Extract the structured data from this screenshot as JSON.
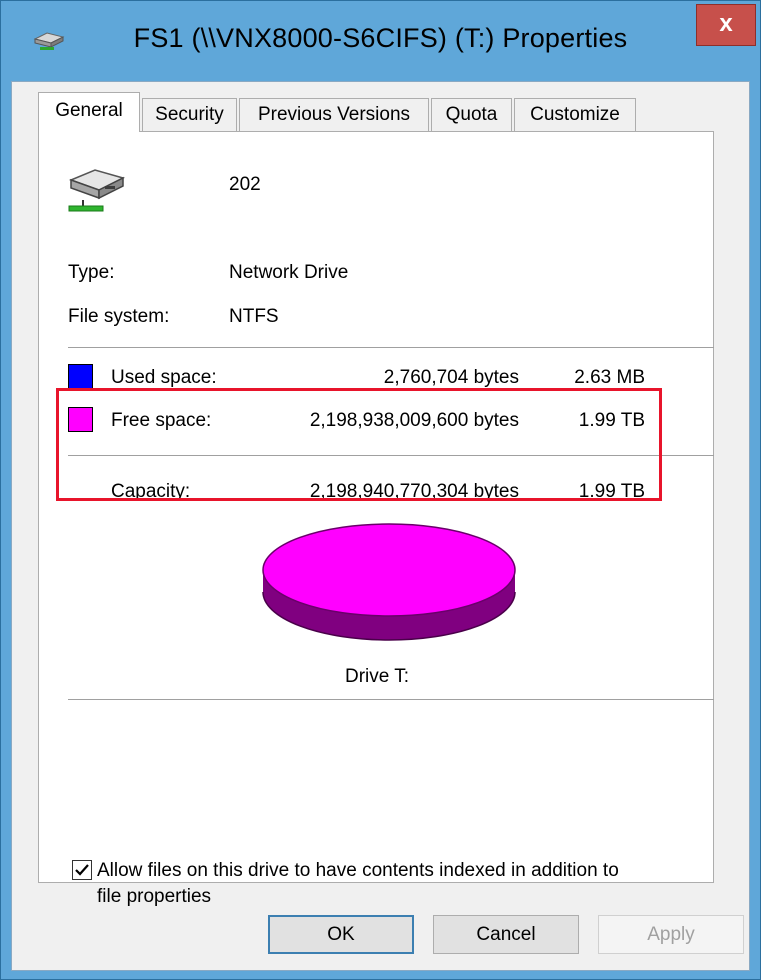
{
  "window": {
    "title": "FS1 (\\\\VNX8000-S6CIFS) (T:) Properties",
    "close_label": "x"
  },
  "tabs": [
    {
      "label": "General",
      "active": true
    },
    {
      "label": "Security"
    },
    {
      "label": "Previous Versions"
    },
    {
      "label": "Quota"
    },
    {
      "label": "Customize"
    }
  ],
  "drive": {
    "name": "202",
    "icon": "network-drive-icon",
    "type_label": "Type:",
    "type_value": "Network Drive",
    "fs_label": "File system:",
    "fs_value": "NTFS"
  },
  "space": {
    "used": {
      "label": "Used space:",
      "bytes": "2,760,704 bytes",
      "size": "2.63 MB",
      "color": "#0000ff"
    },
    "free": {
      "label": "Free space:",
      "bytes": "2,198,938,009,600 bytes",
      "size": "1.99 TB",
      "color": "#ff00ff"
    },
    "capacity": {
      "label": "Capacity:",
      "bytes": "2,198,940,770,304 bytes",
      "size": "1.99 TB"
    }
  },
  "chart": {
    "caption": "Drive T:",
    "free_color": "#ff00ff",
    "side_color": "#800080"
  },
  "index_option": {
    "label_line1": "Allow files on this drive to have contents indexed in addition to",
    "label_line2": "file properties",
    "checked": true
  },
  "buttons": {
    "ok": "OK",
    "cancel": "Cancel",
    "apply": "Apply"
  },
  "colors": {
    "highlight": "#e8142b",
    "titlebar": "#5fa7d9",
    "close": "#c7504b"
  }
}
